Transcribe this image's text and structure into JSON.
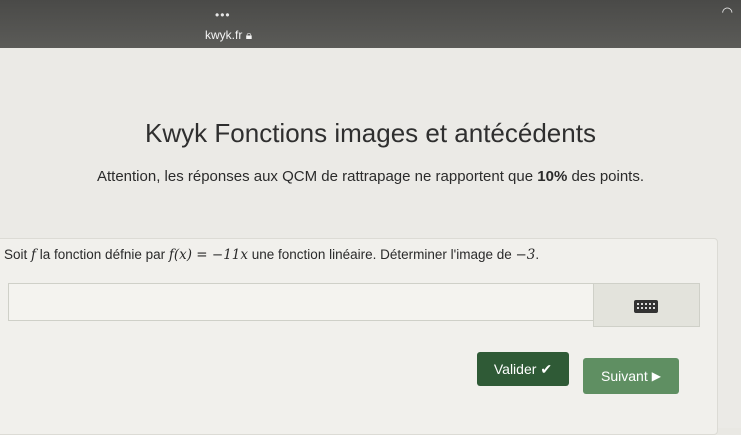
{
  "browser": {
    "url": "kwyk.fr",
    "menu_dots": "•••"
  },
  "page": {
    "title": "Kwyk Fonctions images et antécédents",
    "notice_before": "Attention, les réponses aux QCM de rattrapage ne rapportent que ",
    "notice_bold": "10%",
    "notice_after": " des points."
  },
  "exercise": {
    "question_part1": "Soit ",
    "question_f": "f",
    "question_part2": " la fonction défnie par ",
    "question_formula": "f(x) = −11x",
    "question_part3": " une fonction linéaire. Déterminer l'image de ",
    "question_value": "−3",
    "question_end": ".",
    "answer_value": ""
  },
  "buttons": {
    "validate_label": "Valider",
    "next_label": "Suivant"
  },
  "colors": {
    "validate_bg": "#2f5a36",
    "next_bg": "#5f8f62"
  }
}
